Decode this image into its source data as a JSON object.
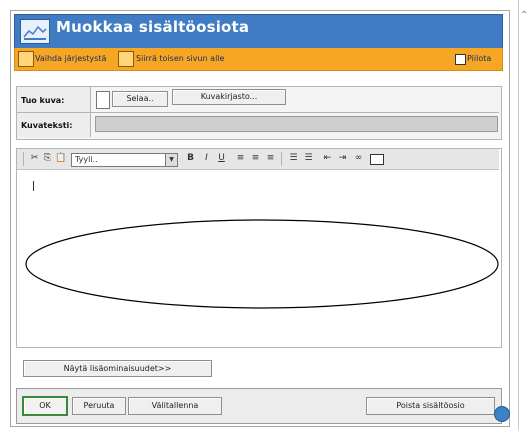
{
  "header": {
    "title": "Muokkaa sisältöosiota"
  },
  "orange_bar": {
    "swap_order": "Vaihda järjestystä",
    "move_below": "Siirrä toisen sivun alle",
    "hide": "Piilota"
  },
  "image_panel": {
    "bring_image_label": "Tuo kuva:",
    "browse_button": "Selaa..",
    "image_library_button": "Kuvakirjasto...",
    "caption_label": "Kuvateksti:"
  },
  "toolbar": {
    "style_select_value": "Tyyli..",
    "icons": [
      "cut-icon",
      "copy-icon",
      "paste-icon",
      "bold-icon",
      "italic-icon",
      "underline-icon",
      "align-left-icon",
      "align-center-icon",
      "align-right-icon",
      "ordered-list-icon",
      "unordered-list-icon",
      "outdent-icon",
      "indent-icon",
      "link-icon",
      "table-icon"
    ]
  },
  "more_properties_button": "Näytä lisäominaisuudet>>",
  "footer": {
    "ok": "OK",
    "cancel": "Peruuta",
    "save_temp": "Välitallenna",
    "delete": "Poista sisältöosio"
  }
}
